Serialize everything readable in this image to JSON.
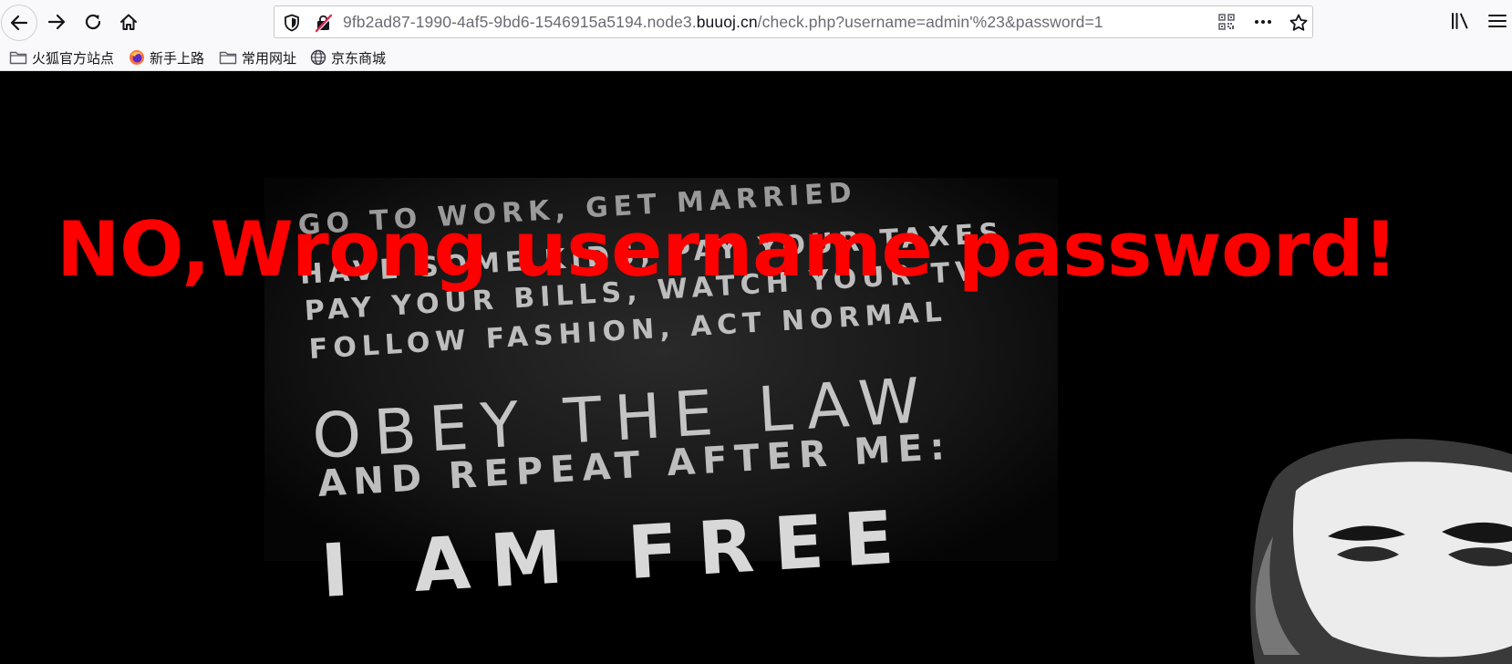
{
  "browser": {
    "url_prefix": "9fb2ad87-1990-4af5-9bd6-1546915a5194.node3.",
    "url_domain": "buuoj.cn",
    "url_suffix": "/check.php?username=admin'%23&password=1"
  },
  "bookmarks": [
    {
      "label": "火狐官方站点",
      "icon": "folder-icon"
    },
    {
      "label": "新手上路",
      "icon": "firefox-icon"
    },
    {
      "label": "常用网址",
      "icon": "folder-icon"
    },
    {
      "label": "京东商城",
      "icon": "globe-icon"
    }
  ],
  "page": {
    "error_message": "NO,Wrong username password!",
    "poster_lines": [
      "GO TO WORK, GET MARRIED",
      "HAVE SOME KIDS, PAY YOUR TAXES",
      "PAY YOUR BILLS, WATCH YOUR TV",
      "FOLLOW FASHION, ACT NORMAL",
      "OBEY THE LAW",
      "AND REPEAT AFTER ME:",
      "I AM FREE"
    ]
  },
  "colors": {
    "error_text": "#fe0000",
    "page_background": "#000000",
    "chrome_background": "#f9f9fb"
  }
}
